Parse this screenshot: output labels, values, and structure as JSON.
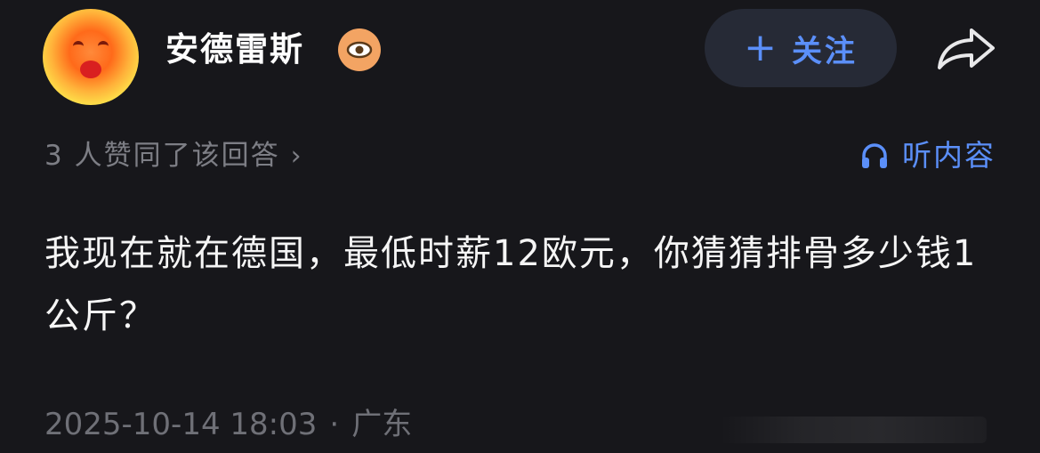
{
  "author": {
    "name": "安德雷斯",
    "badge_icon": "eye-badge-icon"
  },
  "follow_button": {
    "plus": "+",
    "label": "关注"
  },
  "share_icon": "share-arrow-icon",
  "upvote_summary": {
    "text": "3 人赞同了该回答",
    "chevron": "›"
  },
  "listen_button": {
    "icon": "headphones-icon",
    "label": "听内容"
  },
  "answer": {
    "text": "我现在就在德国，最低时薪12欧元，你猜猜排骨多少钱1公斤？"
  },
  "meta": {
    "timestamp": "2025-10-14 18:03",
    "separator": "·",
    "location": "广东"
  },
  "colors": {
    "background": "#17171b",
    "accent": "#5b8ff9",
    "muted_text": "#7d7e85",
    "badge": "#f3a463"
  }
}
